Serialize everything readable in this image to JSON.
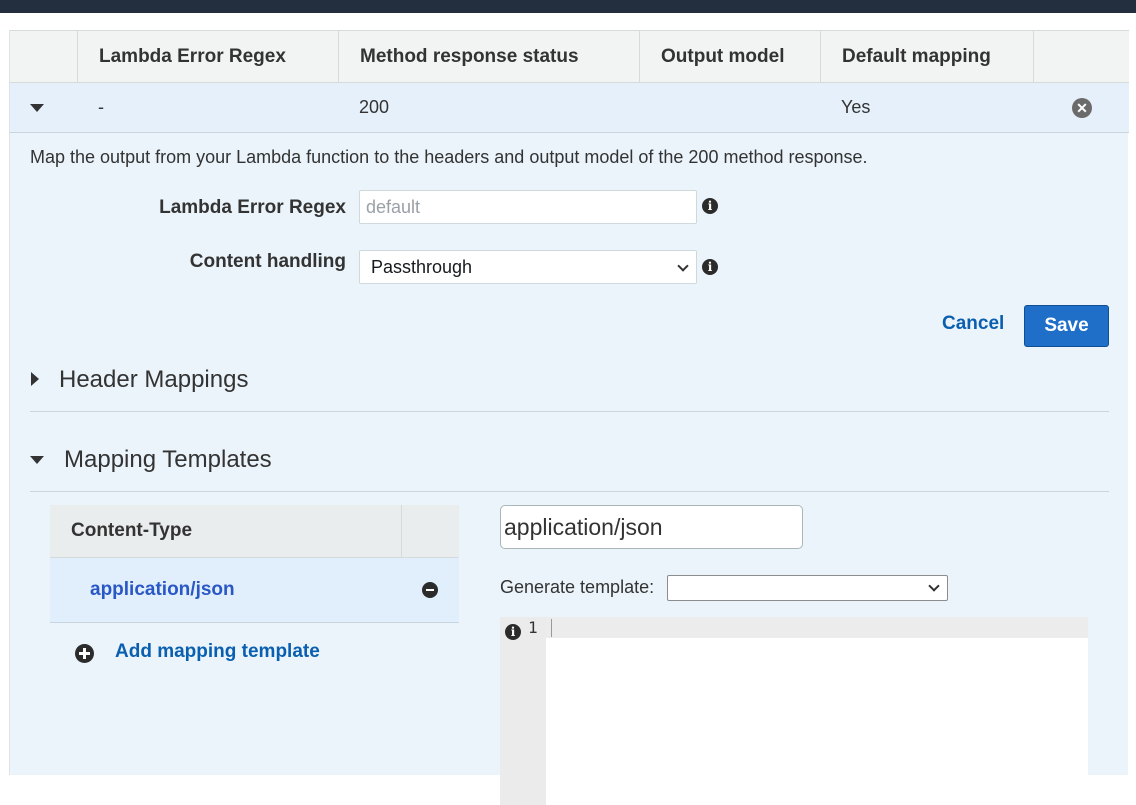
{
  "table": {
    "columns": [
      "Lambda Error Regex",
      "Method response status",
      "Output model",
      "Default mapping"
    ],
    "row": {
      "lambda_error_regex": "-",
      "method_response_status": "200",
      "output_model": "",
      "default_mapping": "Yes"
    }
  },
  "detail": {
    "description": "Map the output from your Lambda function to the headers and output model of the 200 method response.",
    "lambda_error_regex_label": "Lambda Error Regex",
    "lambda_error_regex_placeholder": "default",
    "content_handling_label": "Content handling",
    "content_handling_value": "Passthrough",
    "cancel_label": "Cancel",
    "save_label": "Save"
  },
  "header_mappings": {
    "title": "Header Mappings"
  },
  "mapping_templates": {
    "title": "Mapping Templates",
    "content_type_header": "Content-Type",
    "items": [
      "application/json"
    ],
    "add_label": "Add mapping template",
    "content_type_input_value": "application/json",
    "generate_template_label": "Generate template:",
    "generate_template_value": "",
    "editor_line_number": "1"
  },
  "colors": {
    "topbar": "#232f3e",
    "accent_link": "#0a5fb0",
    "save_button": "#1f6fc9",
    "selected_row": "#e6f0fa"
  }
}
